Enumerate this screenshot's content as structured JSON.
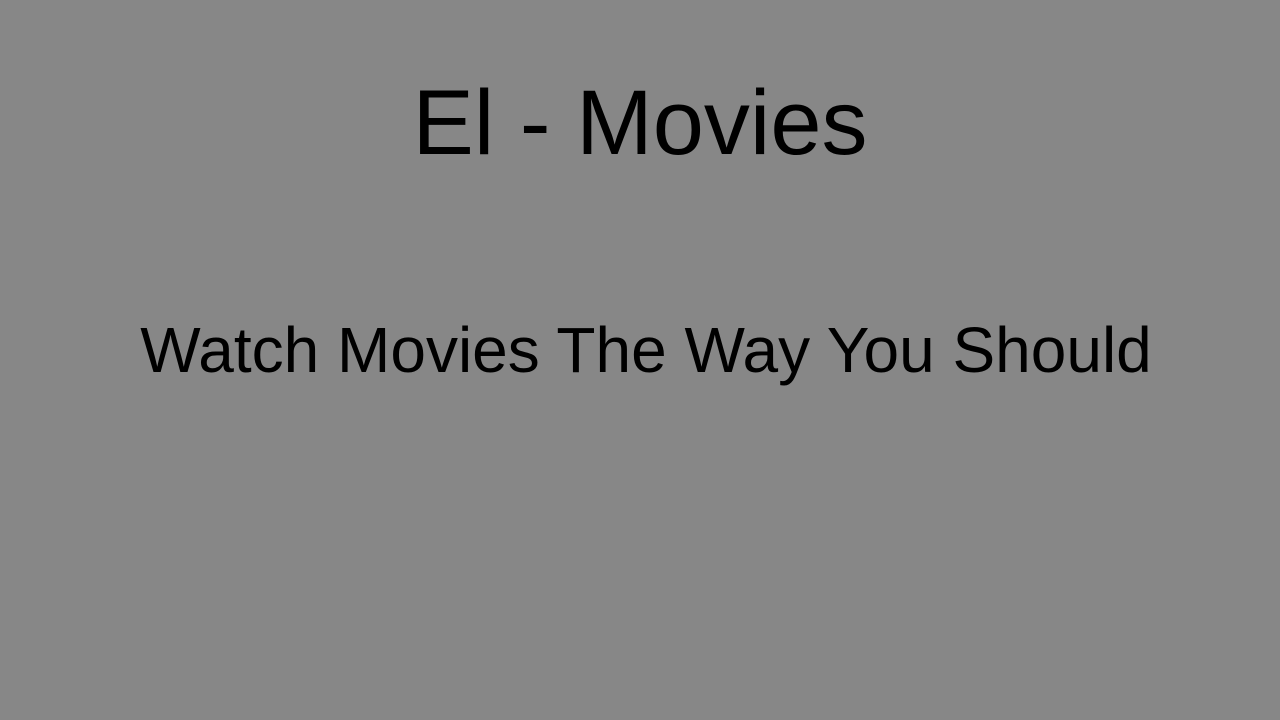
{
  "page": {
    "title": "El - Movies",
    "tagline": "Watch Movies The Way You Should",
    "background_color": "#878787",
    "text_color": "#000000"
  }
}
